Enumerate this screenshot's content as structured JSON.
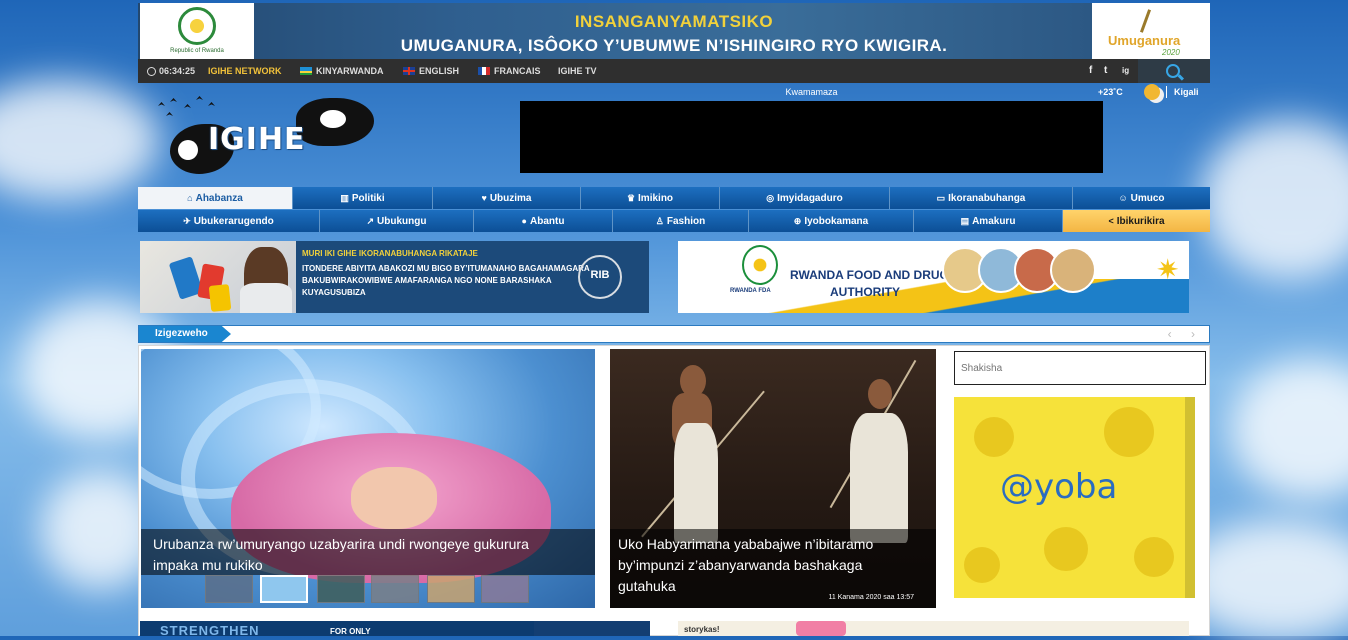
{
  "banner": {
    "seal_text": "Republic of Rwanda",
    "theme_title": "INSANGANYAMATSIKO",
    "theme_sub": "UMUGANURA, ISÔOKO Y’UBUMWE N’ISHINGIRO RYO KWIGIRA.",
    "umuganura_label": "Umuganura",
    "umuganura_year": "2020"
  },
  "topbar": {
    "time": "06:34:25",
    "network": "IGIHE NETWORK",
    "languages": [
      "KINYARWANDA",
      "ENGLISH",
      "FRANCAIS"
    ],
    "tv": "IGIHE TV",
    "social": [
      "f",
      "t",
      "ig"
    ],
    "accent": "#f2c23a"
  },
  "header": {
    "logo_text": "IGIHE",
    "ad_label": "Kwamamaza",
    "temperature": "+23˚C",
    "city": "Kigali"
  },
  "nav": {
    "row1": [
      {
        "label": "Ahabanza",
        "icon": "home-icon"
      },
      {
        "label": "Politiki",
        "icon": "building-icon"
      },
      {
        "label": "Ubuzima",
        "icon": "heart-icon"
      },
      {
        "label": "Imikino",
        "icon": "trophy-icon"
      },
      {
        "label": "Imyidagaduro",
        "icon": "target-icon"
      },
      {
        "label": "Ikoranabuhanga",
        "icon": "laptop-icon"
      },
      {
        "label": "Umuco",
        "icon": "mask-icon"
      }
    ],
    "row2": [
      {
        "label": "Ubukerarugendo",
        "icon": "plane-icon"
      },
      {
        "label": "Ubukungu",
        "icon": "chart-icon"
      },
      {
        "label": "Abantu",
        "icon": "users-icon"
      },
      {
        "label": "Fashion",
        "icon": "dress-icon"
      },
      {
        "label": "Iyobokamana",
        "icon": "plus-circle-icon"
      },
      {
        "label": "Amakuru",
        "icon": "newspaper-icon"
      },
      {
        "label": "Ibikurikira",
        "icon": "share-icon"
      }
    ]
  },
  "ads": {
    "rib_head": "MURI IKI GIHE IKORANABUHANGA RIKATAJE",
    "rib_body": "ITONDERE ABIYITA ABAKOZI MU BIGO BY’ITUMANAHO BAGAHAMAGARA BAKUBWIRAKOWIBWE AMAFARANGA NGO NONE BARASHAKA KUYAGUSUBIZA",
    "rib_badge": "RIB",
    "fda_emblem_label": "RWANDA FDA",
    "fda_title_line1": "RWANDA FOOD AND DRUGS",
    "fda_title_line2": "AUTHORITY"
  },
  "latest": {
    "tag": "Izigezweho",
    "arrows": "‹ ›"
  },
  "content": {
    "feature1_title": "Urubanza rw’umuryango uzabyarira undi rwongeye gukurura impaka mu rukiko",
    "feature2_title": "Uko Habyarimana yababajwe n’ibitaramo by’impunzi z’abanyarwanda bashakaga gutahuka",
    "feature2_date": "11 Kanama 2020 saa 13:57",
    "search_placeholder": "Shakisha",
    "sponsor_logo": "@yoba"
  },
  "bottom": {
    "left_text": "STRENGTHEN",
    "left_only": "FOR ONLY",
    "right_text": "storykas!"
  }
}
